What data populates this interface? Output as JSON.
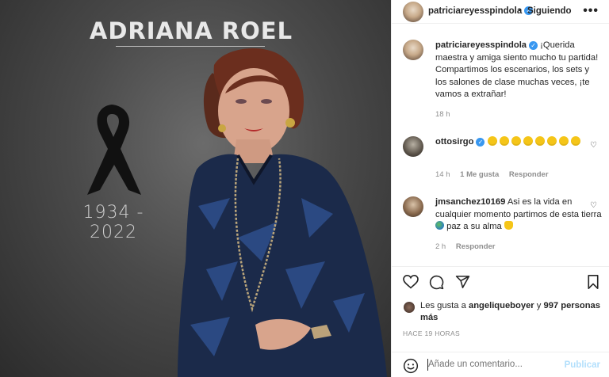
{
  "post_image": {
    "name": "ADRIANA ROEL",
    "years": "1934 - 2022"
  },
  "header": {
    "username": "patriciareyesspindola",
    "separator": "•",
    "follow_status": "Siguiendo",
    "more": "•••"
  },
  "caption": {
    "username": "patriciareyesspindola",
    "text": "¡Querida maestra y amiga siento mucho tu partida! Compartimos los escenarios, los sets y los salones de clase muchas veces, ¡te vamos a extrañar!",
    "time": "18 h"
  },
  "comments": [
    {
      "username": "ottosirgo",
      "emoji_count": 8,
      "emoji": "sad-face-emoji",
      "time": "14 h",
      "likes": "1 Me gusta",
      "reply": "Responder"
    },
    {
      "username": "jmsanchez10169",
      "text_a": "Asi es la vida en cualquier momento partimos de esta tierra",
      "text_b": "paz a su alma",
      "time": "2 h",
      "reply": "Responder"
    }
  ],
  "likes": {
    "prefix": "Les gusta a",
    "user": "angeliqueboyer",
    "connector": "y",
    "others": "997 personas más"
  },
  "timestamp": "HACE 19 HORAS",
  "add_comment": {
    "placeholder": "Añade un comentario...",
    "post_label": "Publicar"
  },
  "colors": {
    "verified": "#3897f0",
    "post_disabled": "#b2dffc",
    "emoji": "#f5c518",
    "muted": "#8e8e8e"
  }
}
